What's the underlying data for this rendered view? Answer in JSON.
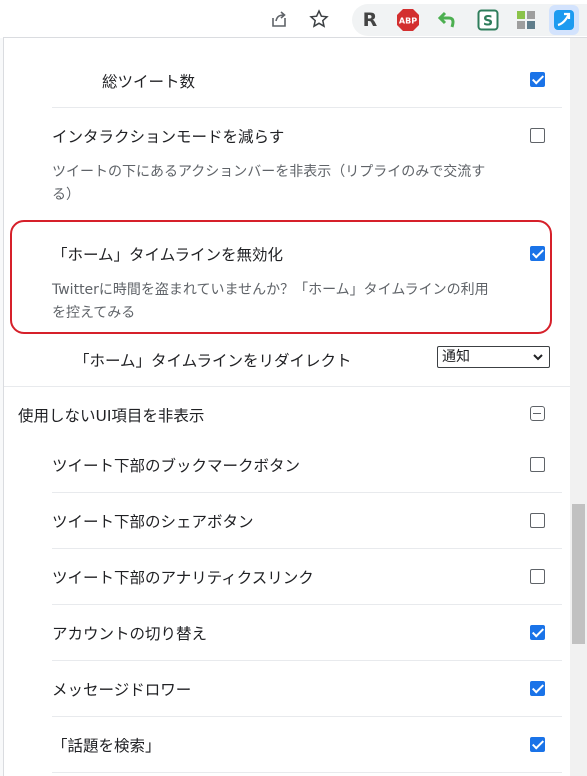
{
  "browser": {
    "share_icon": "share-icon",
    "bookmark_icon": "star-icon",
    "extensions": [
      {
        "name": "r-extension-icon",
        "label": "R"
      },
      {
        "name": "adblock-plus-icon",
        "label": "ABP"
      },
      {
        "name": "green-arrow-extension-icon",
        "label": ""
      },
      {
        "name": "s-extension-icon",
        "label": "S"
      },
      {
        "name": "puzzle-extension-icon",
        "label": ""
      },
      {
        "name": "active-extension-icon",
        "label": ""
      }
    ]
  },
  "settings": {
    "total_tweets": {
      "label": "総ツイート数",
      "checked": true
    },
    "reduce_interaction": {
      "label": "インタラクションモードを減らす",
      "desc": "ツイートの下にあるアクションバーを非表示（リプライのみで交流する）",
      "checked": false
    },
    "disable_home": {
      "label": "「ホーム」タイムラインを無効化",
      "desc": "Twitterに時間を盗まれていませんか？「ホーム」タイムラインの利用を控えてみる",
      "checked": true
    },
    "redirect_home": {
      "label": "「ホーム」タイムラインをリダイレクト",
      "selected": "通知"
    },
    "hide_ui_section": {
      "title": "使用しないUI項目を非表示",
      "items": [
        {
          "label": "ツイート下部のブックマークボタン",
          "checked": false
        },
        {
          "label": "ツイート下部のシェアボタン",
          "checked": false
        },
        {
          "label": "ツイート下部のアナリティクスリンク",
          "checked": false
        },
        {
          "label": "アカウントの切り替え",
          "checked": true
        },
        {
          "label": "メッセージドロワー",
          "checked": true
        },
        {
          "label": "「話題を検索」",
          "checked": true
        }
      ]
    }
  },
  "colors": {
    "accent": "#1a73e8",
    "highlight": "#d6202a"
  }
}
